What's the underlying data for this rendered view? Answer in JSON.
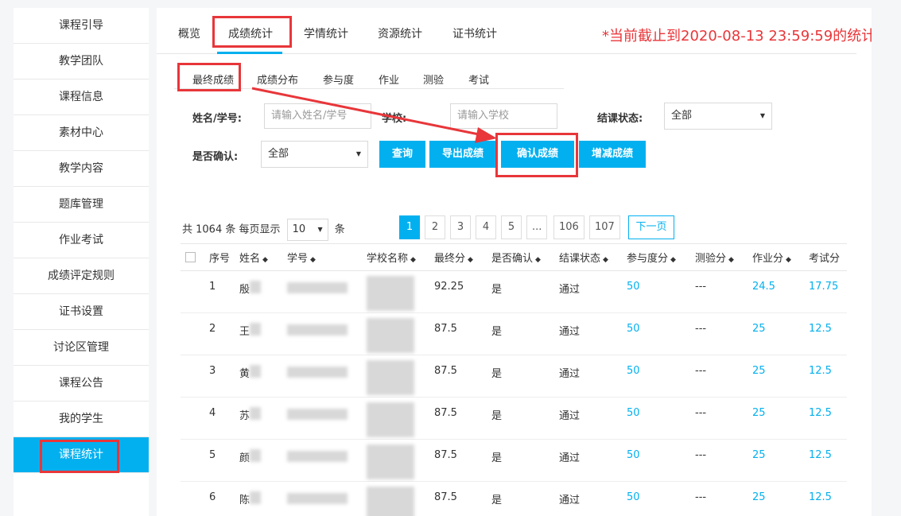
{
  "sidebar": {
    "items": [
      {
        "label": "课程引导"
      },
      {
        "label": "教学团队"
      },
      {
        "label": "课程信息"
      },
      {
        "label": "素材中心"
      },
      {
        "label": "教学内容"
      },
      {
        "label": "题库管理"
      },
      {
        "label": "作业考试"
      },
      {
        "label": "成绩评定规则"
      },
      {
        "label": "证书设置"
      },
      {
        "label": "讨论区管理"
      },
      {
        "label": "课程公告"
      },
      {
        "label": "我的学生"
      },
      {
        "label": "课程统计",
        "active": true
      }
    ]
  },
  "tabs": [
    "概览",
    "成绩统计",
    "学情统计",
    "资源统计",
    "证书统计"
  ],
  "active_tab": "成绩统计",
  "notice": "*当前截止到2020-08-13 23:59:59的统计",
  "subtabs": [
    "最终成绩",
    "成绩分布",
    "参与度",
    "作业",
    "测验",
    "考试"
  ],
  "filters": {
    "name_label": "姓名/学号:",
    "name_placeholder": "请输入姓名/学号",
    "school_label": "学校:",
    "school_placeholder": "请输入学校",
    "status_label": "结课状态:",
    "status_value": "全部",
    "confirm_label": "是否确认:",
    "confirm_value": "全部"
  },
  "buttons": {
    "query": "查询",
    "export": "导出成绩",
    "confirm": "确认成绩",
    "adjust": "增减成绩"
  },
  "pagination": {
    "total_prefix": "共 1064 条 每页显示",
    "page_size": "10",
    "total_suffix": "条",
    "pages": [
      "1",
      "2",
      "3",
      "4",
      "5",
      "...",
      "106",
      "107"
    ],
    "next": "下一页"
  },
  "table": {
    "headers": [
      "序号",
      "姓名",
      "学号",
      "学校名称",
      "最终分",
      "是否确认",
      "结课状态",
      "参与度分",
      "测验分",
      "作业分",
      "考试分"
    ],
    "rows": [
      {
        "idx": "1",
        "name": "殷",
        "final": "92.25",
        "confirmed": "是",
        "status": "通过",
        "participation": "50",
        "quiz": "---",
        "homework": "24.5",
        "exam": "17.75"
      },
      {
        "idx": "2",
        "name": "王",
        "final": "87.5",
        "confirmed": "是",
        "status": "通过",
        "participation": "50",
        "quiz": "---",
        "homework": "25",
        "exam": "12.5"
      },
      {
        "idx": "3",
        "name": "黄",
        "final": "87.5",
        "confirmed": "是",
        "status": "通过",
        "participation": "50",
        "quiz": "---",
        "homework": "25",
        "exam": "12.5"
      },
      {
        "idx": "4",
        "name": "苏",
        "final": "87.5",
        "confirmed": "是",
        "status": "通过",
        "participation": "50",
        "quiz": "---",
        "homework": "25",
        "exam": "12.5"
      },
      {
        "idx": "5",
        "name": "颜",
        "final": "87.5",
        "confirmed": "是",
        "status": "通过",
        "participation": "50",
        "quiz": "---",
        "homework": "25",
        "exam": "12.5"
      },
      {
        "idx": "6",
        "name": "陈",
        "final": "87.5",
        "confirmed": "是",
        "status": "通过",
        "participation": "50",
        "quiz": "---",
        "homework": "25",
        "exam": "12.5"
      }
    ]
  },
  "colors": {
    "accent": "#03b0ef",
    "highlight": "#e8363a"
  }
}
